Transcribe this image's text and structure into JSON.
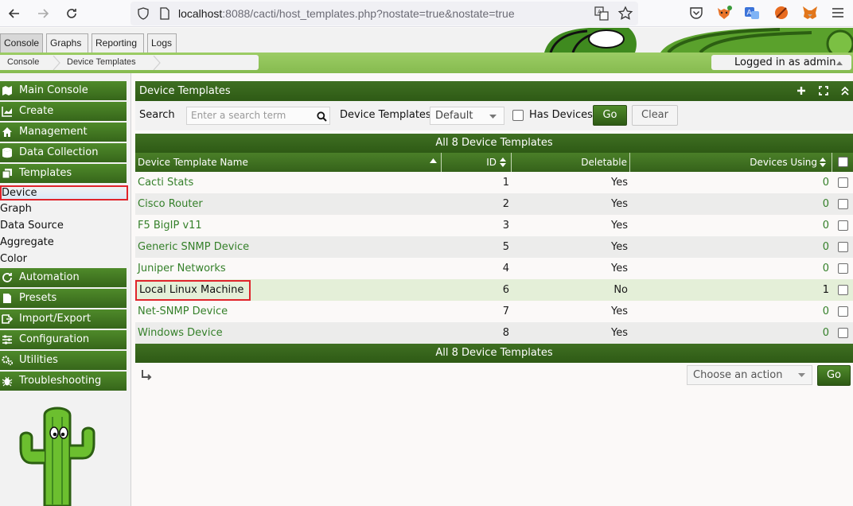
{
  "browser": {
    "url_host": "localhost",
    "url_rest": ":8088/cacti/host_templates.php?nostate=true&nostate=true"
  },
  "tabs": [
    {
      "label": "Console",
      "active": true
    },
    {
      "label": "Graphs",
      "active": false
    },
    {
      "label": "Reporting",
      "active": false
    },
    {
      "label": "Logs",
      "active": false
    }
  ],
  "breadcrumb": [
    "Console",
    "Device Templates"
  ],
  "user": {
    "label": "Logged in as admin"
  },
  "sidebar": {
    "sections_top": [
      {
        "label": "Main Console",
        "icon": "map-icon"
      },
      {
        "label": "Create",
        "icon": "chart-icon"
      },
      {
        "label": "Management",
        "icon": "home-icon"
      },
      {
        "label": "Data Collection",
        "icon": "database-icon"
      },
      {
        "label": "Templates",
        "icon": "copy-icon"
      }
    ],
    "template_items": [
      {
        "label": "Device",
        "selected": true
      },
      {
        "label": "Graph",
        "selected": false
      },
      {
        "label": "Data Source",
        "selected": false
      },
      {
        "label": "Aggregate",
        "selected": false
      },
      {
        "label": "Color",
        "selected": false
      }
    ],
    "sections_bottom": [
      {
        "label": "Automation",
        "icon": "refresh-icon"
      },
      {
        "label": "Presets",
        "icon": "file-icon"
      },
      {
        "label": "Import/Export",
        "icon": "export-icon"
      },
      {
        "label": "Configuration",
        "icon": "sliders-icon"
      },
      {
        "label": "Utilities",
        "icon": "gears-icon"
      },
      {
        "label": "Troubleshooting",
        "icon": "bug-icon"
      }
    ]
  },
  "panel": {
    "title": "Device Templates",
    "search_label": "Search",
    "search_placeholder": "Enter a search term",
    "template_filter_label": "Device Templates",
    "template_filter_value": "Default",
    "has_devices_label": "Has Devices",
    "go_label": "Go",
    "clear_label": "Clear"
  },
  "table": {
    "band_label": "All 8 Device Templates",
    "columns": [
      "Device Template Name",
      "ID",
      "Deletable",
      "Devices Using"
    ],
    "rows": [
      {
        "name": "Cacti Stats",
        "id": "1",
        "deletable": "Yes",
        "devices": "0"
      },
      {
        "name": "Cisco Router",
        "id": "2",
        "deletable": "Yes",
        "devices": "0"
      },
      {
        "name": "F5 BigIP v11",
        "id": "3",
        "deletable": "Yes",
        "devices": "0"
      },
      {
        "name": "Generic SNMP Device",
        "id": "5",
        "deletable": "Yes",
        "devices": "0"
      },
      {
        "name": "Juniper Networks",
        "id": "4",
        "deletable": "Yes",
        "devices": "0"
      },
      {
        "name": "Local Linux Machine",
        "id": "6",
        "deletable": "No",
        "devices": "1"
      },
      {
        "name": "Net-SNMP Device",
        "id": "7",
        "deletable": "Yes",
        "devices": "0"
      },
      {
        "name": "Windows Device",
        "id": "8",
        "deletable": "Yes",
        "devices": "0"
      }
    ]
  },
  "actions": {
    "select_label": "Choose an action",
    "go_label": "Go"
  },
  "colors": {
    "accent_green": "#35621a",
    "link_green": "#35802a",
    "highlight_red": "#e0242b",
    "breadbar_green": "#9ccc65"
  }
}
